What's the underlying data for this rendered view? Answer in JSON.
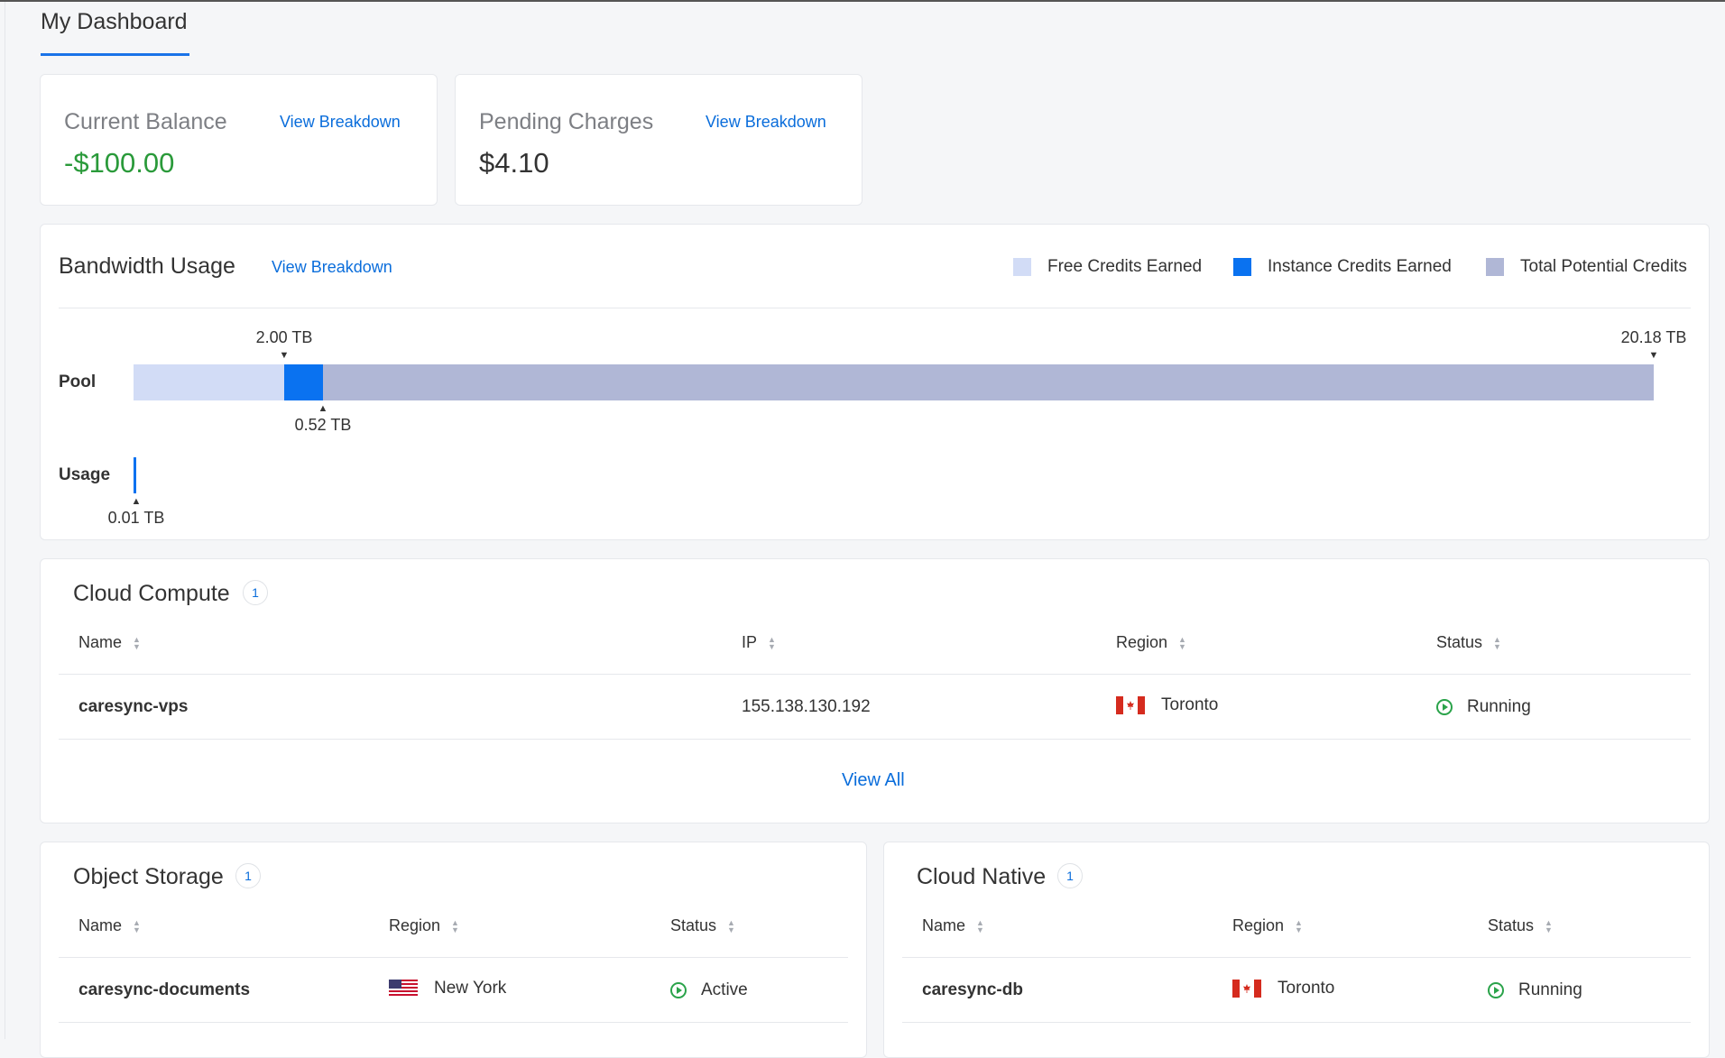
{
  "header": {
    "tab_label": "My Dashboard"
  },
  "balance": {
    "current": {
      "title": "Current Balance",
      "link": "View Breakdown",
      "value": "-$100.00",
      "value_color": "#2a9a3a"
    },
    "pending": {
      "title": "Pending Charges",
      "link": "View Breakdown",
      "value": "$4.10",
      "value_color": "#333333"
    }
  },
  "bandwidth": {
    "title": "Bandwidth Usage",
    "link": "View Breakdown",
    "legend": [
      {
        "label": "Free Credits Earned",
        "color": "#d2dcf6"
      },
      {
        "label": "Instance Credits Earned",
        "color": "#0a72f0"
      },
      {
        "label": "Total Potential Credits",
        "color": "#b0b7d6"
      }
    ],
    "pool_label": "Pool",
    "usage_label": "Usage",
    "markers": {
      "free": "2.00 TB",
      "instance": "0.52 TB",
      "total": "20.18 TB",
      "usage": "0.01 TB"
    }
  },
  "compute": {
    "title": "Cloud Compute",
    "count": "1",
    "headers": [
      "Name",
      "IP",
      "Region",
      "Status"
    ],
    "row": {
      "name": "caresync-vps",
      "ip": "155.138.130.192",
      "region": "Toronto",
      "status": "Running"
    },
    "view_all": "View All"
  },
  "storage": {
    "title": "Object Storage",
    "count": "1",
    "headers": [
      "Name",
      "Region",
      "Status"
    ],
    "row": {
      "name": "caresync-documents",
      "region": "New York",
      "status": "Active"
    }
  },
  "native": {
    "title": "Cloud Native",
    "count": "1",
    "headers": [
      "Name",
      "Region",
      "Status"
    ],
    "row": {
      "name": "caresync-db",
      "region": "Toronto",
      "status": "Running"
    }
  }
}
